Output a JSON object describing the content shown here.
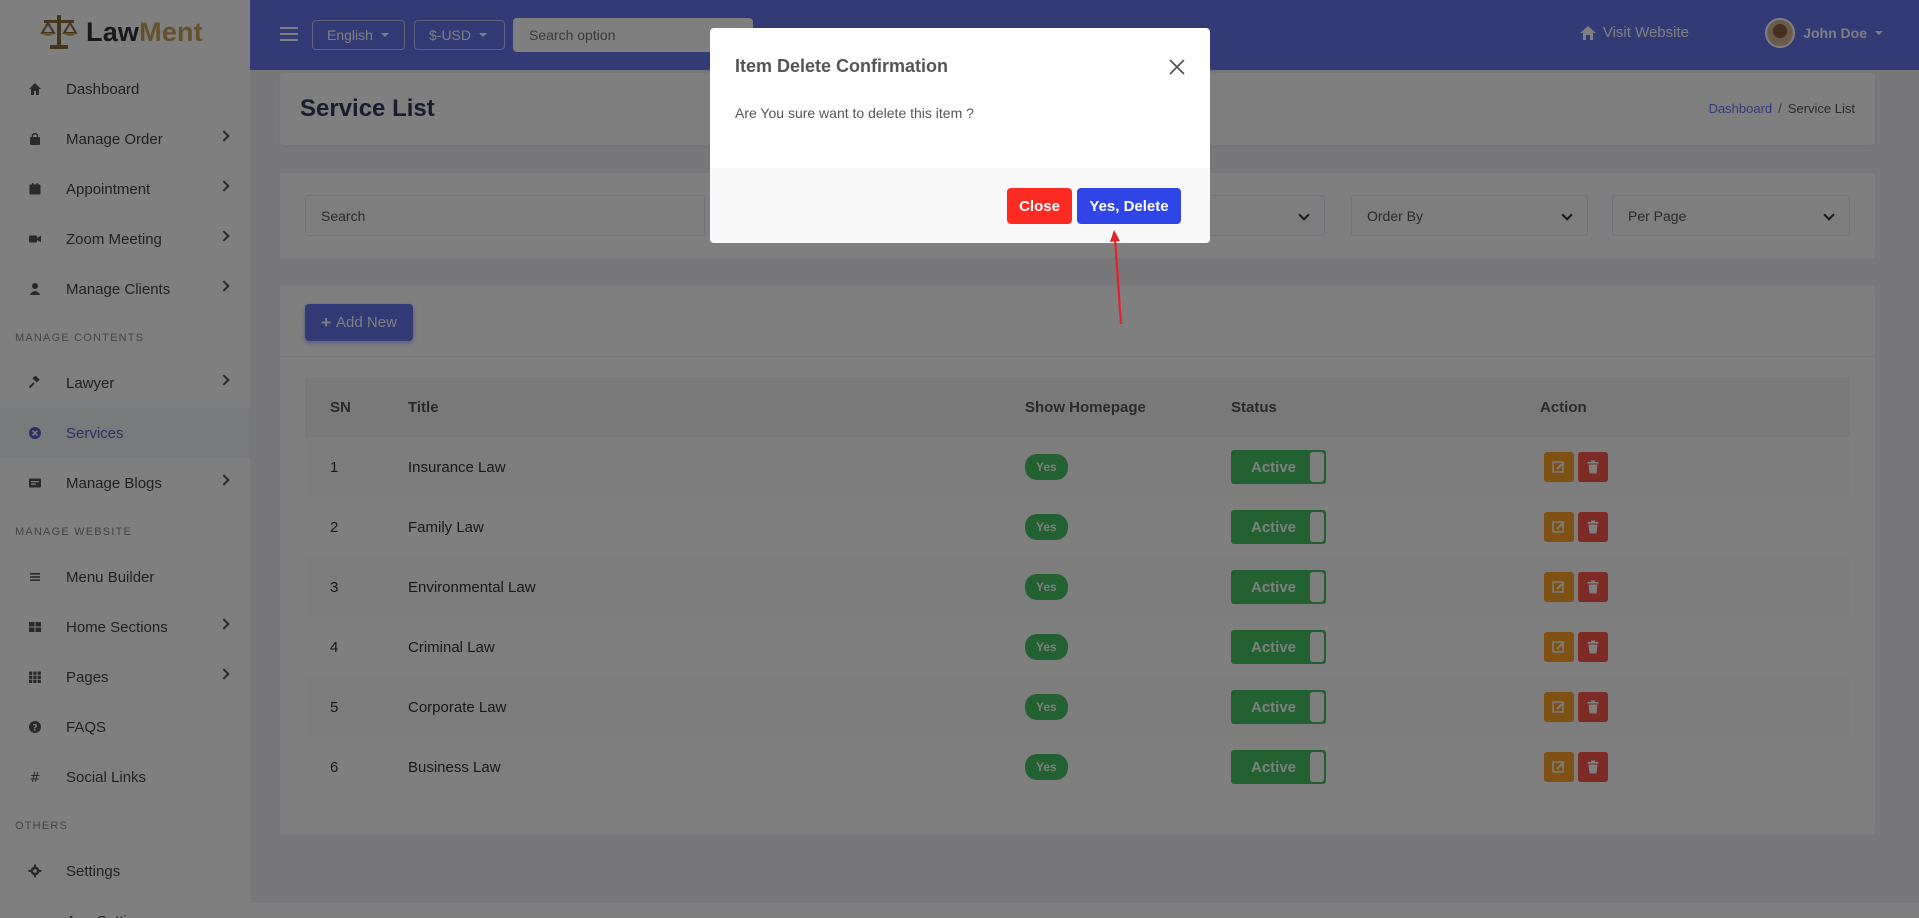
{
  "brand": {
    "logo_part1": "Law",
    "logo_part2": "Ment"
  },
  "sidebar": {
    "items_top": [
      {
        "label": "Dashboard",
        "icon": "home-icon",
        "chevron": false
      },
      {
        "label": "Manage Order",
        "icon": "bag-icon",
        "chevron": true
      },
      {
        "label": "Appointment",
        "icon": "calendar-icon",
        "chevron": true
      },
      {
        "label": "Zoom Meeting",
        "icon": "video-icon",
        "chevron": true
      },
      {
        "label": "Manage Clients",
        "icon": "user-icon",
        "chevron": true
      }
    ],
    "section_contents": "MANAGE CONTENTS",
    "items_contents": [
      {
        "label": "Lawyer",
        "icon": "gavel-icon",
        "chevron": true
      },
      {
        "label": "Services",
        "icon": "services-icon",
        "chevron": false,
        "active": true
      },
      {
        "label": "Manage Blogs",
        "icon": "blog-icon",
        "chevron": true
      }
    ],
    "section_website": "MANAGE WEBSITE",
    "items_website": [
      {
        "label": "Menu Builder",
        "icon": "menu-icon",
        "chevron": false
      },
      {
        "label": "Home Sections",
        "icon": "grid-icon",
        "chevron": true
      },
      {
        "label": "Pages",
        "icon": "pages-icon",
        "chevron": true
      },
      {
        "label": "FAQS",
        "icon": "question-icon",
        "chevron": false
      },
      {
        "label": "Social Links",
        "icon": "hash-icon",
        "chevron": false
      }
    ],
    "section_others": "OTHERS",
    "items_others": [
      {
        "label": "Settings",
        "icon": "gear-icon",
        "chevron": false
      },
      {
        "label": "App Settings",
        "icon": "app-settings-icon",
        "chevron": false
      }
    ]
  },
  "topbar": {
    "language": "English",
    "currency": "$-USD",
    "search_placeholder": "Search option",
    "visit_website": "Visit Website",
    "user_name": "John Doe"
  },
  "page": {
    "title": "Service List",
    "breadcrumb_home": "Dashboard",
    "breadcrumb_sep": "/",
    "breadcrumb_current": "Service List"
  },
  "filters": {
    "search_placeholder": "Search",
    "order_by": "Order By",
    "per_page": "Per Page"
  },
  "add_new": "Add New",
  "table": {
    "headers": [
      "SN",
      "Title",
      "Show Homepage",
      "Status",
      "Action"
    ],
    "rows": [
      {
        "sn": "1",
        "title": "Insurance Law",
        "homepage": "Yes",
        "status": "Active"
      },
      {
        "sn": "2",
        "title": "Family Law",
        "homepage": "Yes",
        "status": "Active"
      },
      {
        "sn": "3",
        "title": "Environmental Law",
        "homepage": "Yes",
        "status": "Active"
      },
      {
        "sn": "4",
        "title": "Criminal Law",
        "homepage": "Yes",
        "status": "Active"
      },
      {
        "sn": "5",
        "title": "Corporate Law",
        "homepage": "Yes",
        "status": "Active"
      },
      {
        "sn": "6",
        "title": "Business Law",
        "homepage": "Yes",
        "status": "Active"
      }
    ]
  },
  "modal": {
    "title": "Item Delete Confirmation",
    "body": "Are You sure want to delete this item ?",
    "close_label": "Close",
    "confirm_label": "Yes, Delete"
  },
  "colors": {
    "primary": "#6777ef",
    "success": "#47c363",
    "warning": "#ffa426",
    "danger": "#fc544b",
    "confirm": "#2f45e8",
    "close": "#fc2a21"
  }
}
